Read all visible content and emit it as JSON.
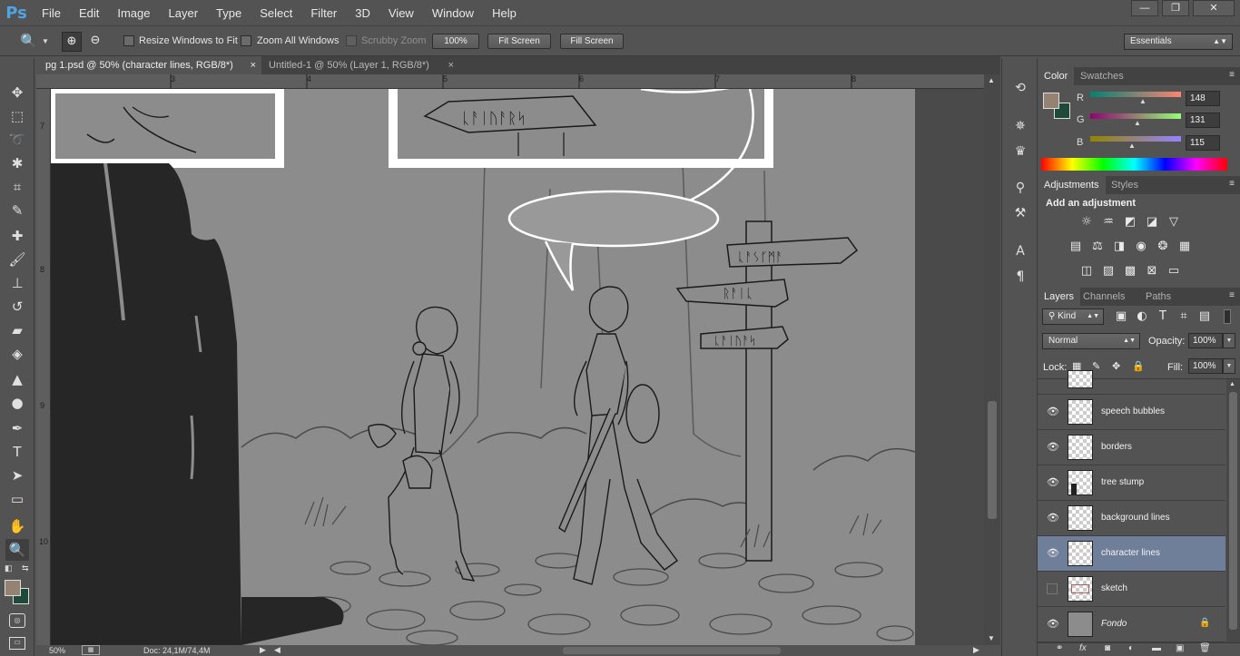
{
  "app": {
    "logo": "Ps"
  },
  "menu": [
    "File",
    "Edit",
    "Image",
    "Layer",
    "Type",
    "Select",
    "Filter",
    "3D",
    "View",
    "Window",
    "Help"
  ],
  "window_controls": {
    "minimize": "—",
    "restore": "❐",
    "close": "✕"
  },
  "options_bar": {
    "resize_windows": "Resize Windows to Fit",
    "zoom_all": "Zoom All Windows",
    "scrubby_zoom": "Scrubby Zoom",
    "zoom_value": "100%",
    "fit_screen": "Fit Screen",
    "fill_screen": "Fill Screen",
    "workspace": "Essentials"
  },
  "doc_tabs": [
    {
      "label": "pg 1.psd @ 50% (character lines, RGB/8*)",
      "close": "×"
    },
    {
      "label": "Untitled-1 @ 50% (Layer 1, RGB/8*)",
      "close": "×"
    }
  ],
  "ruler": {
    "h_labels": [
      "3",
      "4",
      "5",
      "6",
      "7",
      "8"
    ],
    "v_labels": [
      "7",
      "8",
      "9",
      "10"
    ]
  },
  "canvas_text": {
    "sign_top": "ᚳᚨᛁᚢᚨᚱᛋ",
    "sign_1": "ᚳᚨᛊᚴᛗᚨ",
    "sign_2": "ᚱᚨᛁᚳ",
    "sign_3": "ᚳᚨᛁᚢᚨᛋ"
  },
  "status": {
    "zoom": "50%",
    "doc": "Doc: 24,1M/74,4M"
  },
  "color_panel": {
    "tabs": [
      "Color",
      "Swatches"
    ],
    "channels": [
      {
        "label": "R",
        "value": "148",
        "pos": 0.58
      },
      {
        "label": "G",
        "value": "131",
        "pos": 0.51
      },
      {
        "label": "B",
        "value": "115",
        "pos": 0.45
      }
    ],
    "fg_color": "#948373",
    "bg_color": "#1e4a3a"
  },
  "adjustments_panel": {
    "tabs": [
      "Adjustments",
      "Styles"
    ],
    "heading": "Add an adjustment",
    "icons": [
      "brightness-icon",
      "levels-icon",
      "curves-icon",
      "exposure-icon",
      "vibrance-icon",
      "hue-saturation-icon",
      "color-balance-icon",
      "black-white-icon",
      "photo-filter-icon",
      "channel-mixer-icon",
      "color-lookup-icon",
      "invert-icon",
      "posterize-icon",
      "threshold-icon",
      "selective-color-icon",
      "gradient-map-icon"
    ]
  },
  "layers_panel": {
    "tabs": [
      "Layers",
      "Channels",
      "Paths"
    ],
    "filter_kind": "Kind",
    "blend_mode": "Normal",
    "opacity_label": "Opacity:",
    "opacity_value": "100%",
    "lock_label": "Lock:",
    "fill_label": "Fill:",
    "fill_value": "100%",
    "layers": [
      {
        "name": "speech bubbles",
        "visible": true,
        "selected": false,
        "locked": false
      },
      {
        "name": "borders",
        "visible": true,
        "selected": false,
        "locked": false
      },
      {
        "name": "tree stump",
        "visible": true,
        "selected": false,
        "locked": false
      },
      {
        "name": "background lines",
        "visible": true,
        "selected": false,
        "locked": false
      },
      {
        "name": "character lines",
        "visible": true,
        "selected": true,
        "locked": false
      },
      {
        "name": "sketch",
        "visible": false,
        "selected": false,
        "locked": false
      },
      {
        "name": "Fondo",
        "visible": true,
        "selected": false,
        "locked": true
      }
    ]
  }
}
